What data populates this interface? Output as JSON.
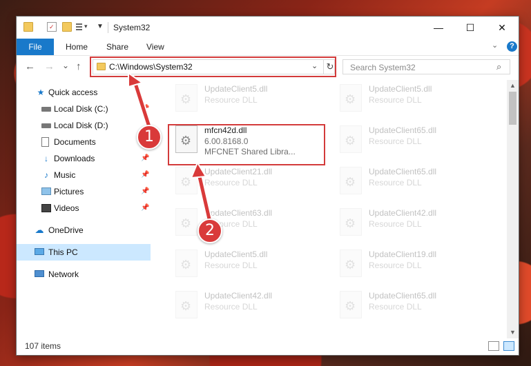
{
  "window": {
    "title": "System32",
    "minimize_symbol": "—",
    "maximize_symbol": "☐",
    "close_symbol": "✕"
  },
  "ribbon": {
    "tabs": [
      "File",
      "Home",
      "Share",
      "View"
    ],
    "help_label": "?"
  },
  "navigation": {
    "back_symbol": "←",
    "forward_symbol": "→",
    "recent_symbol": "⌄",
    "up_symbol": "↑",
    "address": "C:\\Windows\\System32",
    "refresh_symbol": "↻",
    "dropdown_symbol": "⌄",
    "search_placeholder": "Search System32"
  },
  "sidebar": {
    "items": [
      {
        "label": "Quick access",
        "icon": "star-icon",
        "pinned": false
      },
      {
        "label": "Local Disk (C:)",
        "icon": "drive-icon",
        "pinned": true
      },
      {
        "label": "Local Disk (D:)",
        "icon": "drive-icon",
        "pinned": false
      },
      {
        "label": "Documents",
        "icon": "documents-icon",
        "pinned": true
      },
      {
        "label": "Downloads",
        "icon": "download-icon",
        "pinned": true
      },
      {
        "label": "Music",
        "icon": "music-icon",
        "pinned": true
      },
      {
        "label": "Pictures",
        "icon": "pictures-icon",
        "pinned": true
      },
      {
        "label": "Videos",
        "icon": "videos-icon",
        "pinned": true
      },
      {
        "label": "OneDrive",
        "icon": "cloud-icon",
        "pinned": false
      },
      {
        "label": "This PC",
        "icon": "computer-icon",
        "pinned": false,
        "selected": true
      },
      {
        "label": "Network",
        "icon": "network-icon",
        "pinned": false
      }
    ]
  },
  "files": {
    "left_column": [
      {
        "name": "UpdateClient5.dll",
        "line2": "Resource DLL"
      },
      {
        "name": "mfcn42d.dll",
        "line2": "6.00.8168.0",
        "line3": "MFCNET Shared Libra..."
      },
      {
        "name": "UpdateClient21.dll",
        "line2": "Resource DLL"
      },
      {
        "name": "UpdateClient63.dll",
        "line2": "Resource DLL"
      },
      {
        "name": "UpdateClient5.dll",
        "line2": "Resource DLL"
      },
      {
        "name": "UpdateClient42.dll",
        "line2": "Resource DLL"
      }
    ],
    "right_column": [
      {
        "name": "UpdateClient5.dll",
        "line2": "Resource DLL"
      },
      {
        "name": "UpdateClient65.dll",
        "line2": "Resource DLL"
      },
      {
        "name": "UpdateClient65.dll",
        "line2": "Resource DLL"
      },
      {
        "name": "UpdateClient42.dll",
        "line2": "Resource DLL"
      },
      {
        "name": "UpdateClient19.dll",
        "line2": "Resource DLL"
      },
      {
        "name": "UpdateClient65.dll",
        "line2": "Resource DLL"
      }
    ]
  },
  "status": {
    "item_count": "107 items"
  },
  "annotations": {
    "step1": "1",
    "step2": "2",
    "accent_color": "#d93a3a"
  }
}
